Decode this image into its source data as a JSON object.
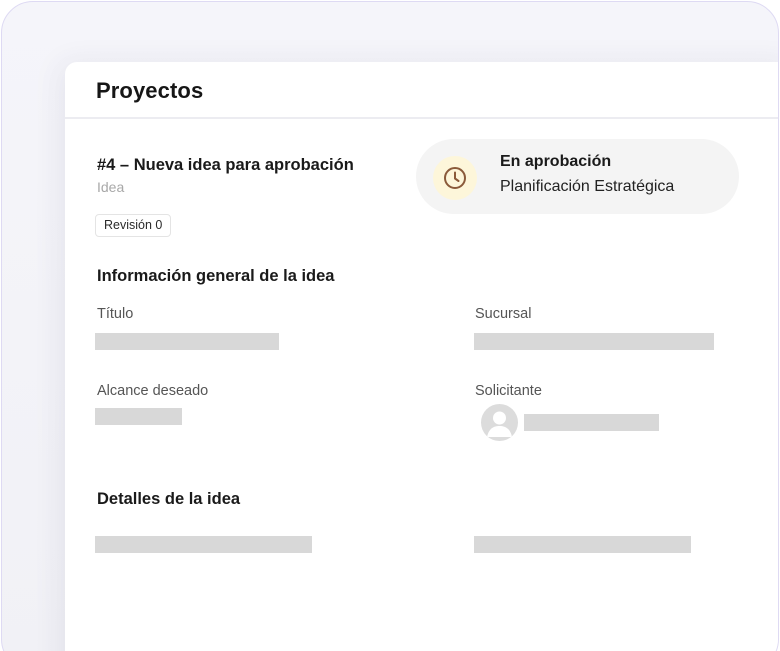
{
  "header": {
    "title": "Proyectos"
  },
  "idea": {
    "title": "#4 – Nueva idea para aprobación",
    "type": "Idea",
    "revision": "Revisión 0"
  },
  "status": {
    "icon": "clock-icon",
    "title": "En aprobación",
    "subtitle": "Planificación Estratégica"
  },
  "general_info": {
    "title": "Información general de la idea",
    "fields": {
      "titulo": "Título",
      "sucursal": "Sucursal",
      "alcance": "Alcance deseado",
      "solicitante": "Solicitante"
    }
  },
  "details": {
    "title": "Detalles de la idea"
  },
  "colors": {
    "frame_border": "#dedaf3",
    "skeleton": "#d8d8d8",
    "clock_bg": "#fdf6da",
    "clock_stroke": "#8a5a3a"
  }
}
